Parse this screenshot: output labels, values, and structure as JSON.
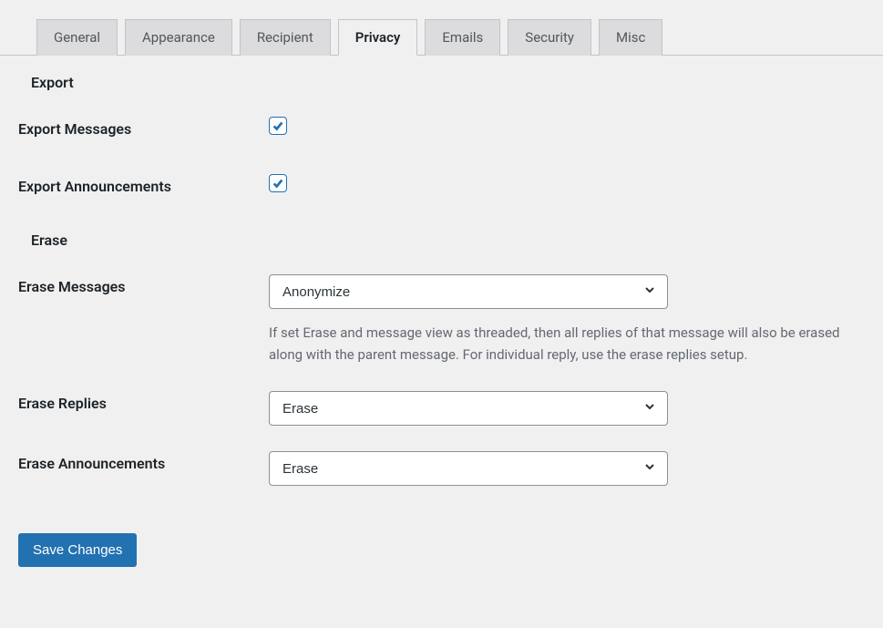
{
  "tabs": {
    "general": "General",
    "appearance": "Appearance",
    "recipient": "Recipient",
    "privacy": "Privacy",
    "emails": "Emails",
    "security": "Security",
    "misc": "Misc"
  },
  "sections": {
    "export": {
      "title": "Export",
      "fields": {
        "export_messages": {
          "label": "Export Messages",
          "checked": true
        },
        "export_announcements": {
          "label": "Export Announcements",
          "checked": true
        }
      }
    },
    "erase": {
      "title": "Erase",
      "fields": {
        "erase_messages": {
          "label": "Erase Messages",
          "value": "Anonymize",
          "help": "If set Erase and message view as threaded, then all replies of that message will also be erased along with the parent message. For individual reply, use the erase replies setup."
        },
        "erase_replies": {
          "label": "Erase Replies",
          "value": "Erase"
        },
        "erase_announcements": {
          "label": "Erase Announcements",
          "value": "Erase"
        }
      }
    }
  },
  "actions": {
    "save": "Save Changes"
  }
}
